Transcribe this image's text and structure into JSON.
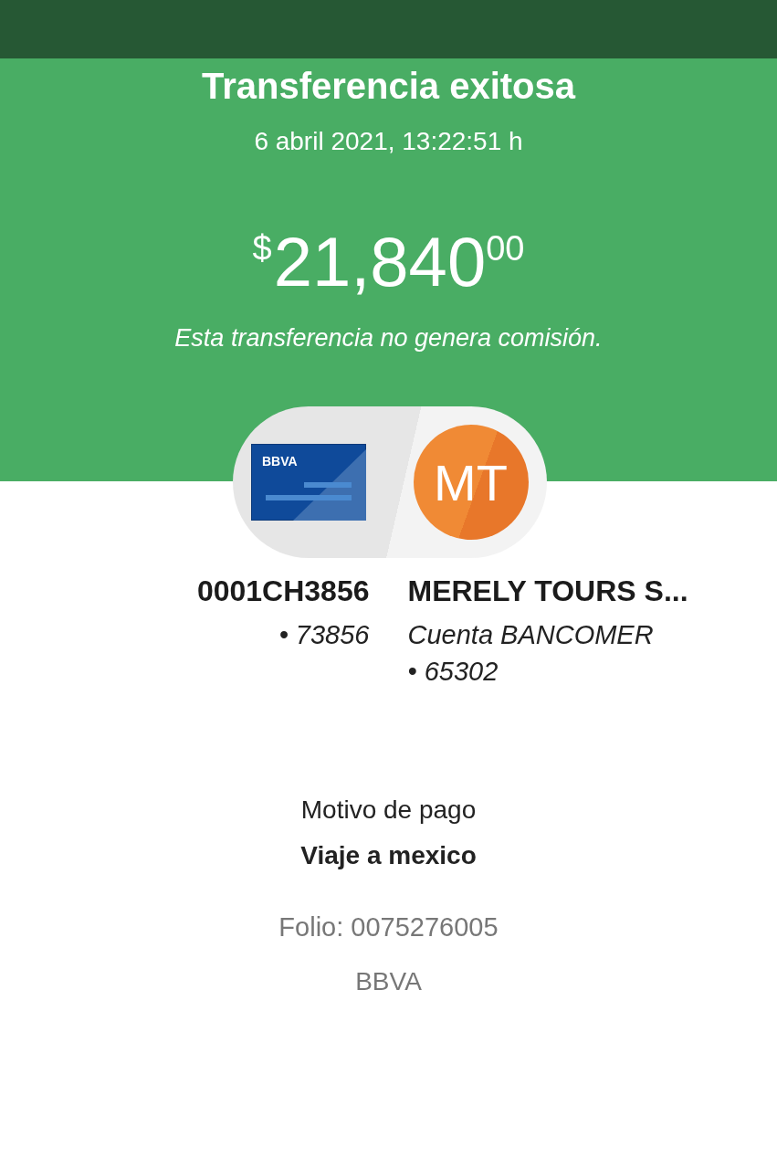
{
  "header": {
    "title": "Transferencia exitosa",
    "date": "6 abril 2021, 13:22:51 h",
    "amount": {
      "currency": "$",
      "integer": "21,840",
      "cents": "00"
    },
    "note": "Esta transferencia no genera comisión."
  },
  "route": {
    "origin_card": {
      "label": "BBVA"
    },
    "destination_avatar": {
      "initials": "MT"
    }
  },
  "origin": {
    "name": "0001CH3856",
    "lines": [
      "• 73856"
    ]
  },
  "destination": {
    "name": "MERELY TOURS S...",
    "lines": [
      "Cuenta BANCOMER",
      "• 65302"
    ]
  },
  "reason": {
    "label": "Motivo de pago",
    "value": "Viaje a mexico"
  },
  "folio": "Folio: 0075276005",
  "bank": "BBVA"
}
